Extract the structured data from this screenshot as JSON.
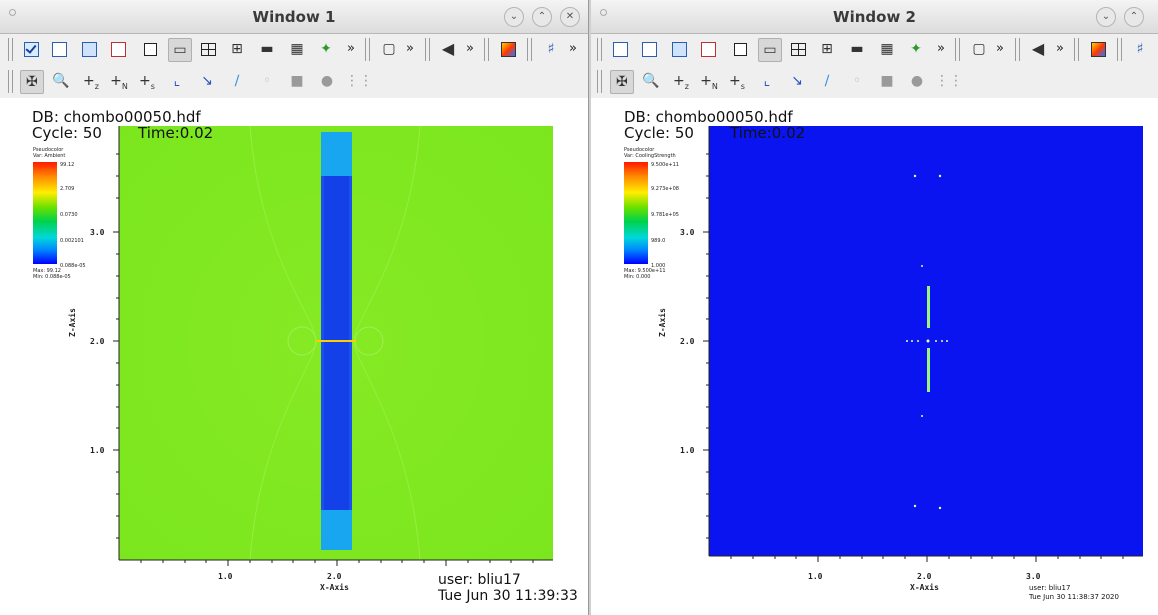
{
  "window1": {
    "title": "Window 1",
    "db": "DB: chombo00050.hdf",
    "cycle": "Cycle: 50",
    "time": "Time:0.02",
    "legend": {
      "type": "Pseudocolor",
      "var": "Var: Ambient",
      "max_label": "Max: 99.12",
      "min_label": "Min: 0.088e-05",
      "ticks": [
        "99.12",
        "2.709",
        "0.0730",
        "0.002101",
        "0.088e-05"
      ]
    },
    "yticks": [
      "3.0",
      "2.0",
      "1.0"
    ],
    "xticks": [
      "1.0",
      "2.0"
    ],
    "ylabel": "Z-Axis",
    "xlabel": "X-Axis",
    "user": "user: bliu17",
    "date": "Tue Jun 30 11:39:33"
  },
  "window2": {
    "title": "Window 2",
    "db": "DB: chombo00050.hdf",
    "cycle": "Cycle: 50",
    "time": "Time:0.02",
    "legend": {
      "type": "Pseudocolor",
      "var": "Var: CoolingStrength",
      "max_label": "Max: 9.500e+11",
      "min_label": "Min: 0.000",
      "ticks": [
        "9.500e+11",
        "9.273e+08",
        "9.781e+05",
        "989.0",
        "1.000"
      ]
    },
    "yticks": [
      "3.0",
      "2.0",
      "1.0"
    ],
    "xticks": [
      "1.0",
      "2.0",
      "3.0"
    ],
    "ylabel": "Z-Axis",
    "xlabel": "X-Axis",
    "user": "user: bliu17",
    "date": "Tue Jun 30 11:38:37 2020"
  },
  "colors": {
    "field_green": "#7de81e",
    "jet_blue": "#1a4cf0",
    "deep_blue": "#0a14f0"
  }
}
